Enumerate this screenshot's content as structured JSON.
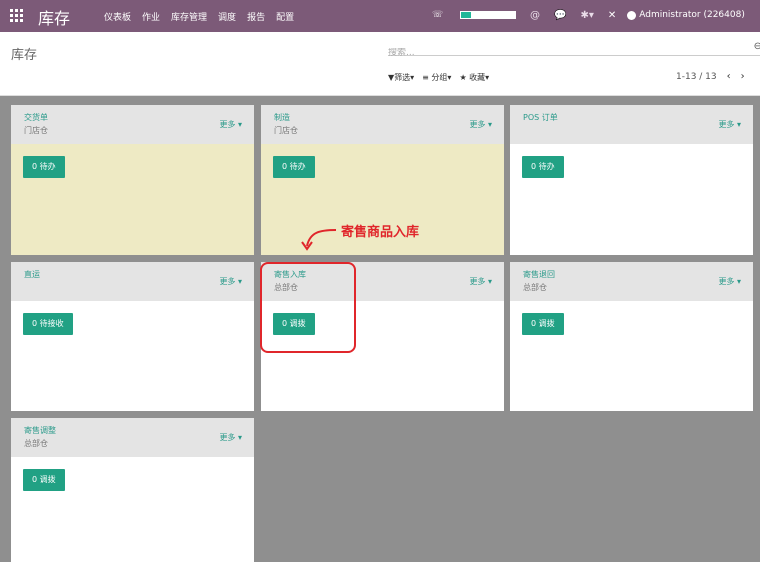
{
  "navbar": {
    "brand": "库存",
    "menu": [
      "仪表板",
      "作业",
      "库存管理",
      "调度",
      "报告",
      "配置"
    ],
    "user": "Administrator (226408)",
    "progress": 0.18,
    "colors": {
      "bar": "#7c5a78",
      "accent": "#21b799"
    }
  },
  "control": {
    "title": "库存",
    "search_placeholder": "搜索...",
    "filters": {
      "filter": "筛选",
      "group": "分组",
      "favorite": "收藏"
    },
    "pager": "1-13 / 13"
  },
  "cards": [
    {
      "name": "交货单",
      "sub": "门店仓",
      "more": "更多",
      "button": "0 待办",
      "body_color": "cream"
    },
    {
      "name": "制造",
      "sub": "门店仓",
      "more": "更多",
      "button": "0 待办",
      "body_color": "cream"
    },
    {
      "name": "POS 订单",
      "sub": "",
      "more": "更多",
      "button": "0 待办",
      "body_color": "white"
    },
    {
      "name": "直运",
      "sub": "",
      "more": "更多",
      "button": "0 待接收",
      "body_color": "white"
    },
    {
      "name": "寄售入库",
      "sub": "总部仓",
      "more": "更多",
      "button": "0 调拨",
      "body_color": "white"
    },
    {
      "name": "寄售退回",
      "sub": "总部仓",
      "more": "更多",
      "button": "0 调拨",
      "body_color": "white"
    },
    {
      "name": "寄售调整",
      "sub": "总部仓",
      "more": "更多",
      "button": "0 调拨",
      "body_color": "white"
    }
  ],
  "annotation": "寄售商品入库"
}
